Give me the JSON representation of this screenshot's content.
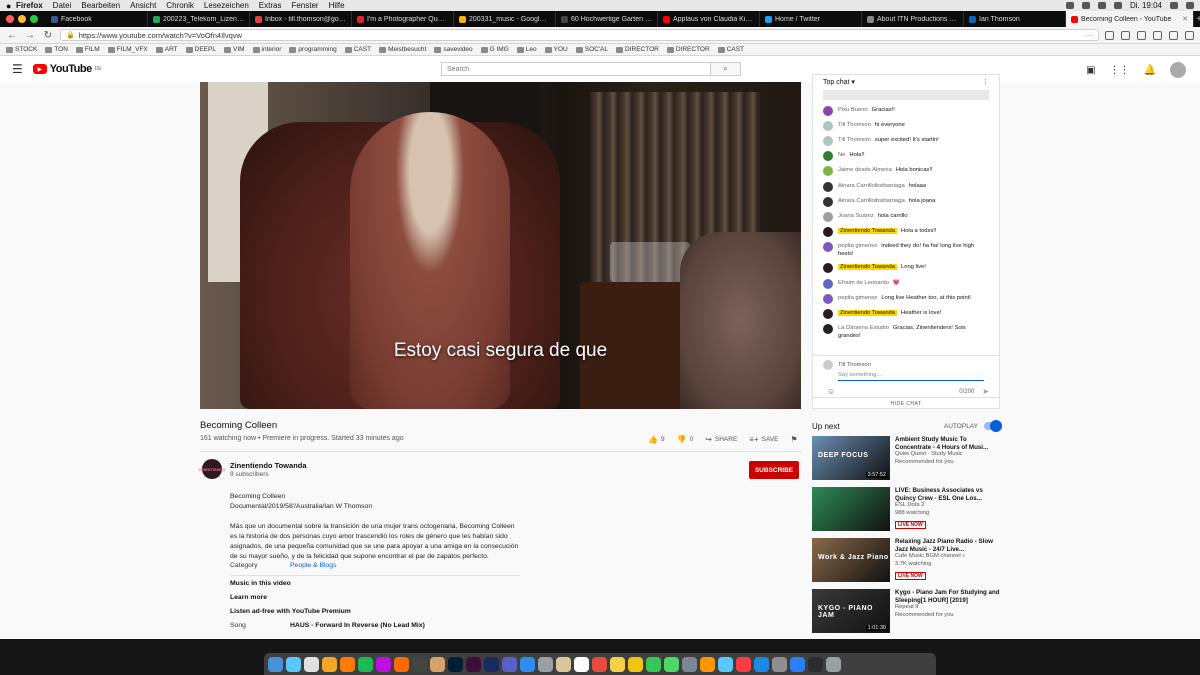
{
  "menubar": {
    "app": "Firefox",
    "items": [
      "Datei",
      "Bearbeiten",
      "Ansicht",
      "Chronik",
      "Lesezeichen",
      "Extras",
      "Fenster",
      "Hilfe"
    ],
    "clock": "Di. 19:04"
  },
  "tabs": [
    {
      "label": "Facebook",
      "color": "#3b5998"
    },
    {
      "label": "200223_Telekom_Lizenzstat...",
      "color": "#23a55a"
    },
    {
      "label": "Inbox - till.thomson@googlem...",
      "color": "#db4437"
    },
    {
      "label": "I'm a Photographer Quarantin...",
      "color": "#d62828"
    },
    {
      "label": "200331_music - Google Drive",
      "color": "#f4b400"
    },
    {
      "label": "60 Hochwertige Garten Strohi...",
      "color": "#444444"
    },
    {
      "label": "Applaus von Claudia Kistler-G...",
      "color": "#ff0000"
    },
    {
      "label": "Home / Twitter",
      "color": "#1da1f2"
    },
    {
      "label": "About ITN Productions | ITN P...",
      "color": "#888888"
    },
    {
      "label": "Ian Thomson",
      "color": "#0a66c2"
    },
    {
      "label": "Becoming Colleen - YouTube",
      "color": "#ff0000",
      "active": true
    }
  ],
  "url": "https://www.youtube.com/watch?v=VoOfn4Ilvqvw",
  "bookmarks": [
    "STOCK",
    "TON",
    "FILM",
    "FILM_VFX",
    "ART",
    "DEEPL",
    "VIM",
    "interior",
    "programming",
    "CAST",
    "Meistbesucht",
    "savevideo",
    "G IMG",
    "Leo",
    "YOU",
    "SOC'AL",
    "DIRECTOR",
    "DIRECTOR",
    "CAST"
  ],
  "youtube": {
    "logo": "YouTube",
    "region": "DE",
    "search_placeholder": "Search"
  },
  "video": {
    "subtitle": "Estoy casi segura de que",
    "title": "Becoming Colleen",
    "stats": "161 watching now • Premiere in progress. Started 33 minutes ago",
    "likes": "9",
    "dislikes": "0",
    "share": "SHARE",
    "save": "SAVE"
  },
  "channel": {
    "name": "Zinentiendo Towanda",
    "subs": "9 subscribers",
    "avatar_text": "ZINENTIENDO",
    "subscribe": "SUBSCRIBE"
  },
  "description": {
    "line1": "Becoming Colleen",
    "line2": "Documental/2019/58'/Australia/Ian W Thomson",
    "para": "Más que un documental sobre la transición de una mujer trans octogenaria, Becoming Colleen es la historia de dos personas cuyo amor trascendió los roles de género que les habían sido asignados, de una pequeña comunidad que se une para apoyar a una amiga en la consecución de su mayor sueño, y de la felicidad que supone encontrar el par de zapatos perfecto.",
    "category_label": "Category",
    "category_value": "People & Blogs",
    "music_label": "Music in this video",
    "learn_more": "Learn more",
    "premium": "Listen ad-free with YouTube Premium",
    "song_label": "Song",
    "song_value": "HAUS - Forward In Reverse (No Lead Mix)"
  },
  "chat": {
    "header": "Top chat",
    "messages": [
      {
        "author": "Pixu Bueno",
        "text": "Gracias!!",
        "color": "#8e44ad",
        "hl": false
      },
      {
        "author": "Till Thomson",
        "text": "hi everyone",
        "color": "#b0c4c8",
        "hl": false
      },
      {
        "author": "Till Thomson",
        "text": "super excited! It's startin!",
        "color": "#b0c4c8",
        "hl": false
      },
      {
        "author": "Ne",
        "text": "Hola!!",
        "color": "#2e7d32",
        "hl": false
      },
      {
        "author": "Jaime desde Almeria",
        "text": "Hola bonicas!!",
        "color": "#7cb342",
        "hl": false
      },
      {
        "author": "Ainara Carrilloibsibarriaga",
        "text": "holaaa",
        "color": "#333333",
        "hl": false
      },
      {
        "author": "Ainara Carrilloibsibarriaga",
        "text": "hola joana",
        "color": "#333333",
        "hl": false
      },
      {
        "author": "Joana Suárez",
        "text": "hola carrillo",
        "color": "#9e9e9e",
        "hl": false
      },
      {
        "author": "Zinentiendo Towanda",
        "text": "Hola a todxs!!",
        "color": "#2b1b20",
        "hl": true
      },
      {
        "author": "pepita gimenez",
        "text": "indeed they do! ha ha! long live high heels!",
        "color": "#7e57c2",
        "hl": false
      },
      {
        "author": "Zinentiendo Towanda",
        "text": "Long live!",
        "color": "#2b1b20",
        "hl": true
      },
      {
        "author": "Efraim de Leonardo",
        "text": "💗",
        "color": "#5c6bc0",
        "hl": false
      },
      {
        "author": "pepita gimenez",
        "text": "Long live Heather too, at this point!",
        "color": "#7e57c2",
        "hl": false
      },
      {
        "author": "Zinentiendo Towanda",
        "text": "Heather is love!",
        "color": "#2b1b20",
        "hl": true
      },
      {
        "author": "La Dársena Estudio",
        "text": "Gracias, Zinentienders! Sois grandes!",
        "color": "#222222",
        "hl": false
      }
    ],
    "input_user": "Till Thomson",
    "input_placeholder": "Say something...",
    "counter": "0/200",
    "hide": "HIDE CHAT"
  },
  "upnext": {
    "label": "Up next",
    "autoplay": "AUTOPLAY",
    "videos": [
      {
        "title": "Ambient Study Music To Concentrate - 4 Hours of Musi...",
        "channel": "Quiet Quest - Study Music",
        "meta": "Recommended for you",
        "duration": "3:57:52",
        "live": "",
        "thumb_text": "DEEP FOCUS",
        "thumb_color": "#6b8fb3"
      },
      {
        "title": "LIVE: Business Associates vs Quincy Crew - ESL One Los...",
        "channel": "ESL Dota 2",
        "meta": "988 watching",
        "duration": "",
        "live": "LIVE NOW",
        "thumb_text": "",
        "thumb_color": "#2e8b57"
      },
      {
        "title": "Relaxing Jazz Piano Radio - Slow Jazz Music - 24/7 Live...",
        "channel": "Cafe Music BGM channel ♪",
        "meta": "3.7K watching",
        "duration": "",
        "live": "LIVE NOW",
        "thumb_text": "Work & Jazz Piano",
        "thumb_color": "#8a6a4a"
      },
      {
        "title": "Kygo - Piano Jam For Studying and Sleeping[1 HOUR] [2019]",
        "channel": "Repeat It",
        "meta": "Recommended for you",
        "duration": "1:01:30",
        "live": "",
        "thumb_text": "KYGO - PIANO JAM",
        "thumb_color": "#3a3a3a"
      }
    ]
  },
  "dock_colors": [
    "#4a90d9",
    "#5ac8fa",
    "#e0e0e0",
    "#f5a623",
    "#ff7b00",
    "#1db954",
    "#bd10e0",
    "#ff6a00",
    "#444444",
    "#d6a36b",
    "#001e36",
    "#3a0f3a",
    "#1b2a5c",
    "#5b5fc7",
    "#2d8cf0",
    "#9aa0a6",
    "#d9c79b",
    "#ffffff",
    "#e74c3c",
    "#f7d046",
    "#f1c40f",
    "#34c759",
    "#4cd964",
    "#7b8794",
    "#ff9500",
    "#5ac8fa",
    "#fc3c44",
    "#1e88e5",
    "#8e8e93",
    "#2a7fff",
    "#2c2c2c",
    "#9aa0a6"
  ]
}
